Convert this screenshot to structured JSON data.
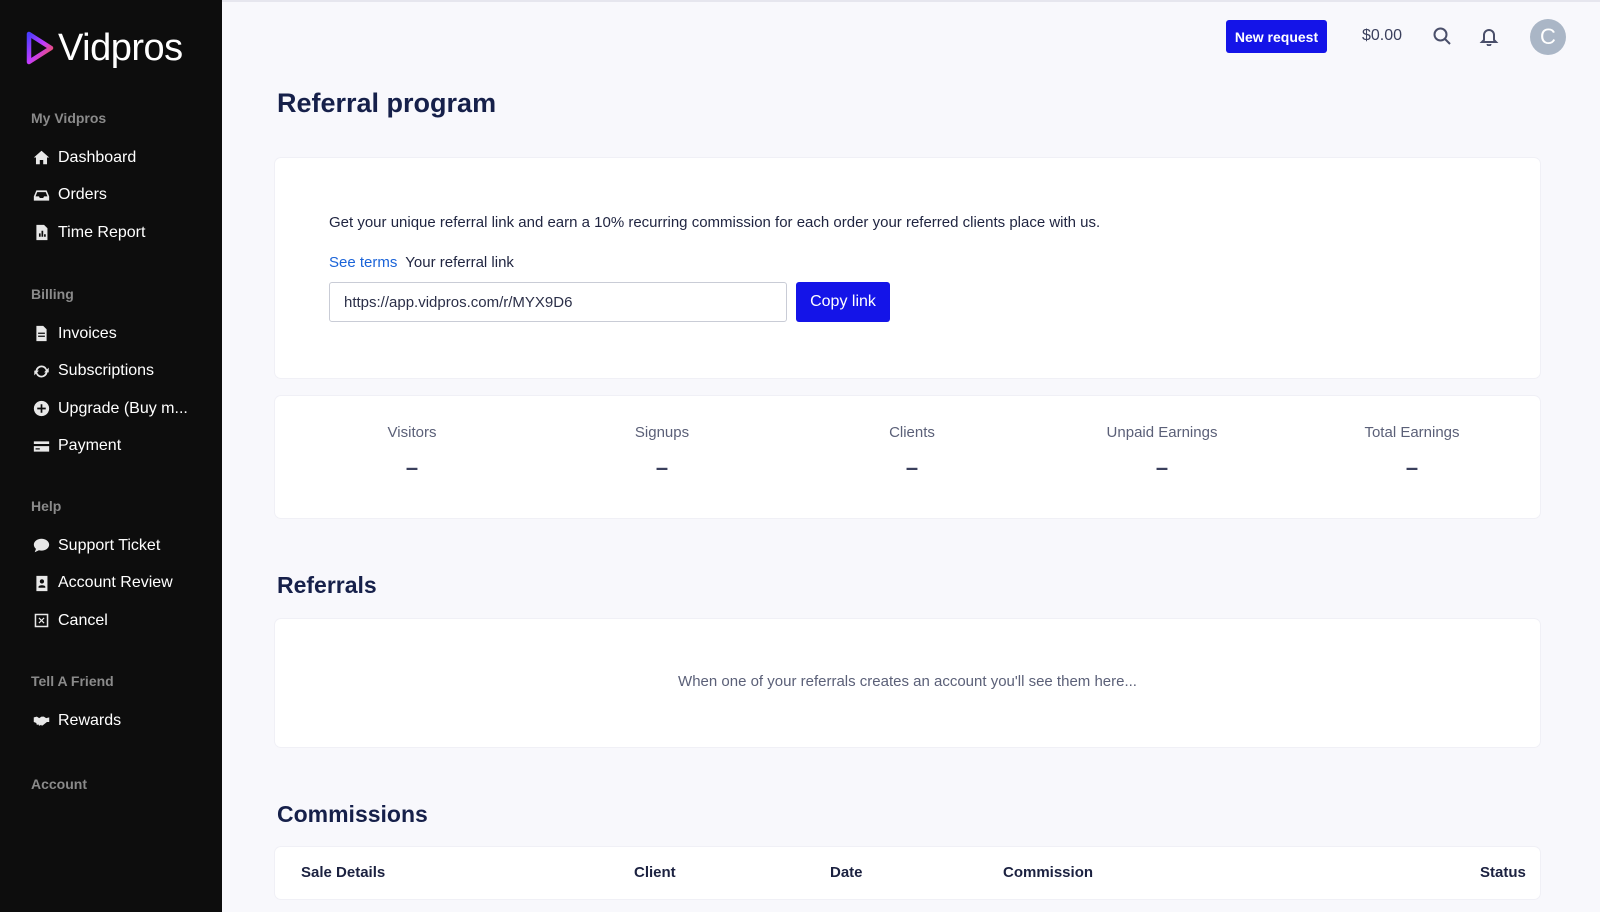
{
  "app": {
    "logo_text": "Vidpros"
  },
  "sidebar": {
    "sections": [
      {
        "heading": "My Vidpros",
        "items": [
          {
            "label": "Dashboard",
            "icon": "home-icon"
          },
          {
            "label": "Orders",
            "icon": "inbox-icon"
          },
          {
            "label": "Time Report",
            "icon": "report-icon"
          }
        ]
      },
      {
        "heading": "Billing",
        "items": [
          {
            "label": "Invoices",
            "icon": "invoice-icon"
          },
          {
            "label": "Subscriptions",
            "icon": "refresh-icon"
          },
          {
            "label": "Upgrade (Buy m...",
            "icon": "plus-circle-icon"
          },
          {
            "label": "Payment",
            "icon": "credit-card-icon"
          }
        ]
      },
      {
        "heading": "Help",
        "items": [
          {
            "label": "Support Ticket",
            "icon": "chat-icon"
          },
          {
            "label": "Account Review",
            "icon": "contact-book-icon"
          },
          {
            "label": "Cancel",
            "icon": "close-box-icon"
          }
        ]
      },
      {
        "heading": "Tell A Friend",
        "items": [
          {
            "label": "Rewards",
            "icon": "handshake-icon"
          }
        ]
      },
      {
        "heading": "Account",
        "items": []
      }
    ]
  },
  "topbar": {
    "new_request_label": "New request",
    "balance": "$0.00",
    "search_icon": "search-icon",
    "notification_icon": "bell-icon",
    "avatar_initial": "C"
  },
  "page": {
    "title": "Referral program",
    "intro": "Get your unique referral link and earn a 10% recurring commission for each order your referred clients place with us.",
    "terms_link": "See terms",
    "referral_link_label": "Your referral link",
    "referral_link_value": "https://app.vidpros.com/r/MYX9D6",
    "copy_button": "Copy link"
  },
  "stats": [
    {
      "label": "Visitors",
      "value": "–"
    },
    {
      "label": "Signups",
      "value": "–"
    },
    {
      "label": "Clients",
      "value": "–"
    },
    {
      "label": "Unpaid Earnings",
      "value": "–"
    },
    {
      "label": "Total Earnings",
      "value": "–"
    }
  ],
  "referrals": {
    "title": "Referrals",
    "empty_message": "When one of your referrals creates an account you'll see them here..."
  },
  "commissions": {
    "title": "Commissions",
    "columns": [
      "Sale Details",
      "Client",
      "Date",
      "Commission",
      "Status"
    ]
  },
  "colors": {
    "accent": "#1414e8",
    "sidebar_bg": "#0d0d0d",
    "link": "#1a63d8"
  }
}
